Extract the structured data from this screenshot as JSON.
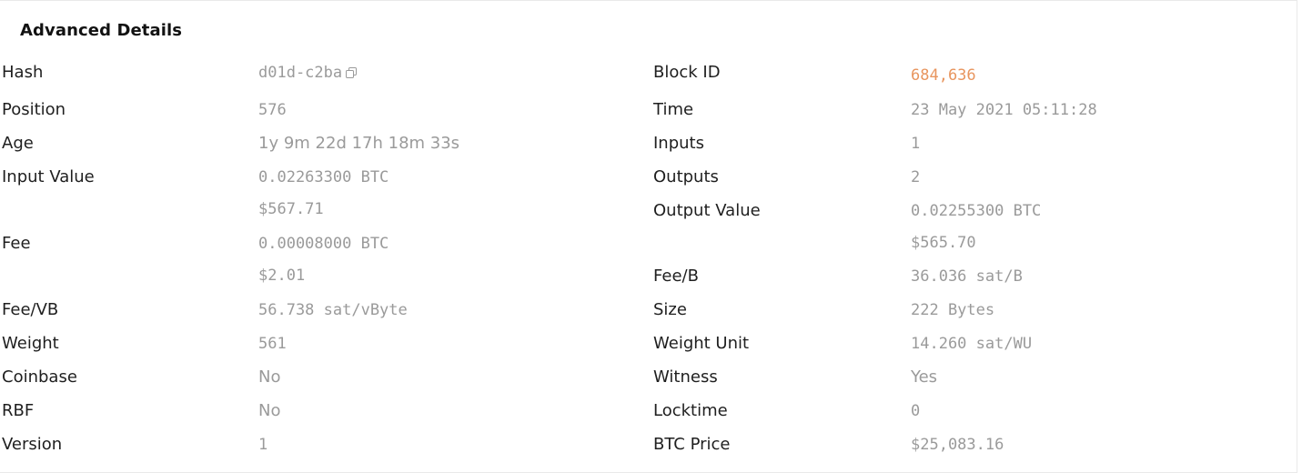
{
  "section": {
    "title": "Advanced Details"
  },
  "left": [
    {
      "label": "Hash",
      "value": "d01d-c2ba"
    },
    {
      "label": "Position",
      "value": "576"
    },
    {
      "label": "Age",
      "value": "1y 9m 22d 17h 18m 33s"
    },
    {
      "label": "Input Value",
      "value": "0.02263300 BTC",
      "sub": "$567.71"
    },
    {
      "label": "Fee",
      "value": "0.00008000 BTC",
      "sub": "$2.01"
    },
    {
      "label": "Fee/VB",
      "value": "56.738 sat/vByte"
    },
    {
      "label": "Weight",
      "value": "561"
    },
    {
      "label": "Coinbase",
      "value": "No"
    },
    {
      "label": "RBF",
      "value": "No"
    },
    {
      "label": "Version",
      "value": "1"
    }
  ],
  "right": [
    {
      "label": "Block ID",
      "value": "684,636"
    },
    {
      "label": "Time",
      "value": "23 May 2021 05:11:28"
    },
    {
      "label": "Inputs",
      "value": "1"
    },
    {
      "label": "Outputs",
      "value": "2"
    },
    {
      "label": "Output Value",
      "value": "0.02255300 BTC",
      "sub": "$565.70"
    },
    {
      "label": "Fee/B",
      "value": "36.036 sat/B"
    },
    {
      "label": "Size",
      "value": "222 Bytes"
    },
    {
      "label": "Weight Unit",
      "value": "14.260 sat/WU"
    },
    {
      "label": "Witness",
      "value": "Yes"
    },
    {
      "label": "Locktime",
      "value": "0"
    },
    {
      "label": "BTC Price",
      "value": "$25,083.16"
    }
  ],
  "icons": {
    "copy": "copy-icon"
  },
  "colors": {
    "accent": "#e8955e",
    "muted": "#9a9a9a",
    "label": "#1f1f1f"
  }
}
